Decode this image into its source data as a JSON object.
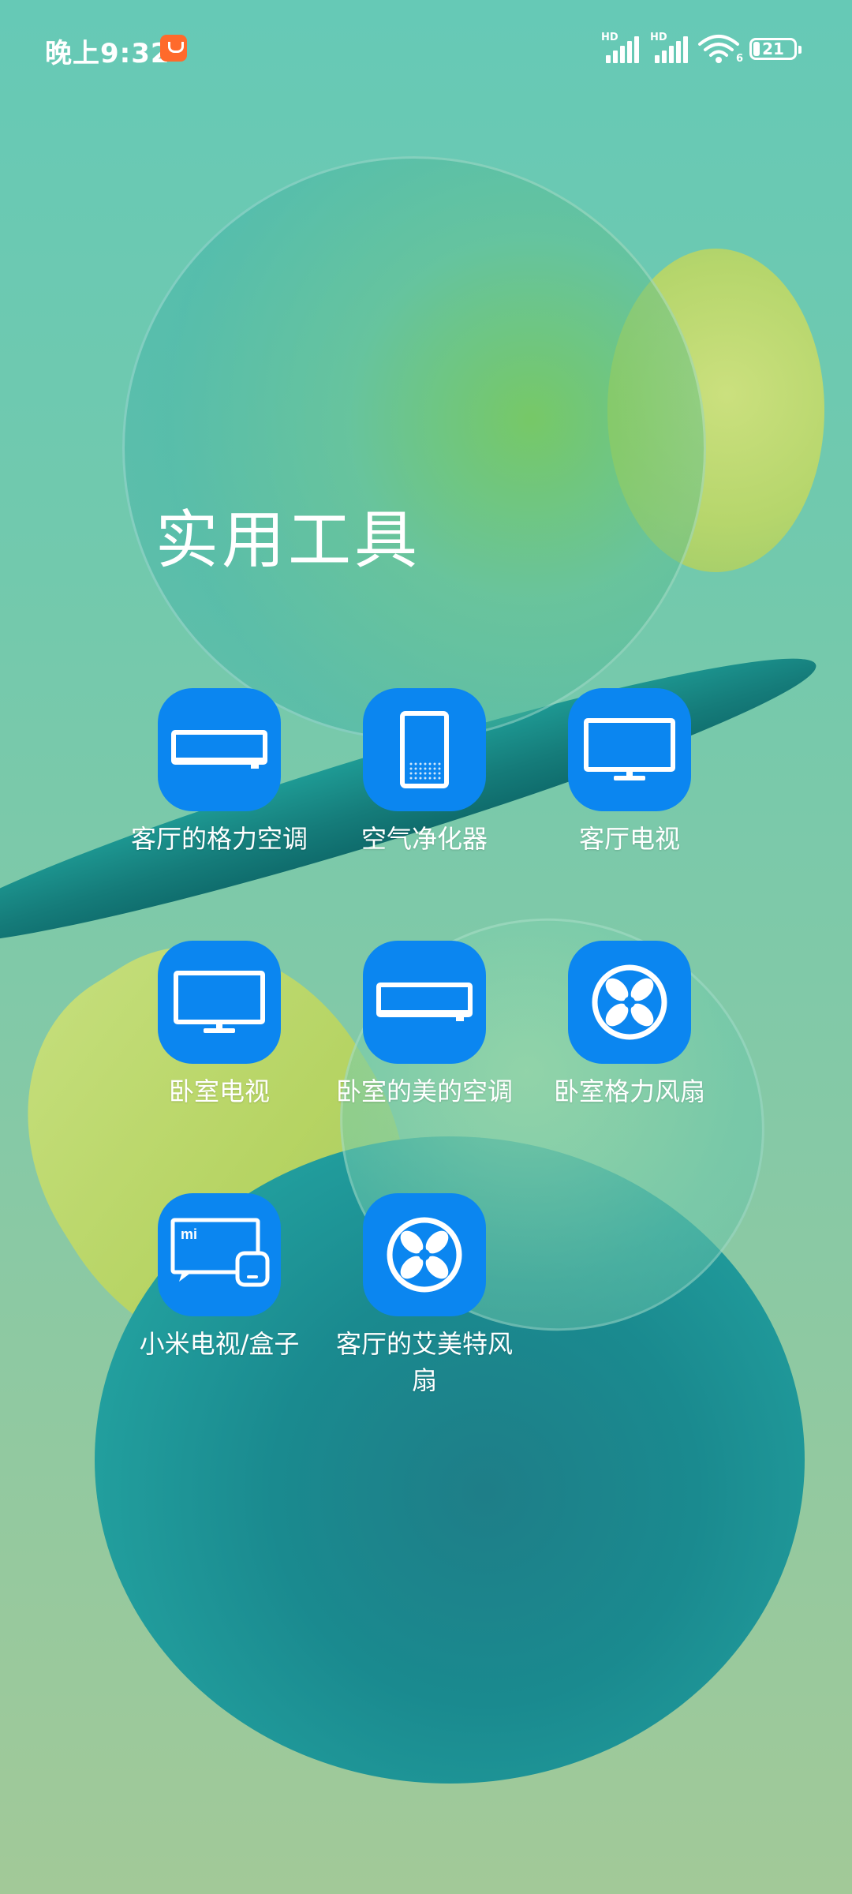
{
  "status_bar": {
    "time": "晚上9:32",
    "signal_label_1": "HD",
    "signal_label_2": "HD",
    "wifi_badge": "6",
    "battery_level": "21"
  },
  "folder": {
    "title": "实用工具"
  },
  "apps": [
    {
      "label": "客厅的格力空调",
      "icon": "air-conditioner-icon"
    },
    {
      "label": "空气净化器",
      "icon": "air-purifier-icon"
    },
    {
      "label": "客厅电视",
      "icon": "tv-icon"
    },
    {
      "label": "卧室电视",
      "icon": "tv-icon"
    },
    {
      "label": "卧室的美的空调",
      "icon": "air-conditioner-icon"
    },
    {
      "label": "卧室格力风扇",
      "icon": "fan-icon"
    },
    {
      "label": "小米电视/盒子",
      "icon": "mi-tv-box-icon"
    },
    {
      "label": "客厅的艾美特风扇",
      "icon": "fan-icon"
    }
  ],
  "colors": {
    "app_icon_bg": "#0b86f0",
    "text": "#ffffff"
  }
}
